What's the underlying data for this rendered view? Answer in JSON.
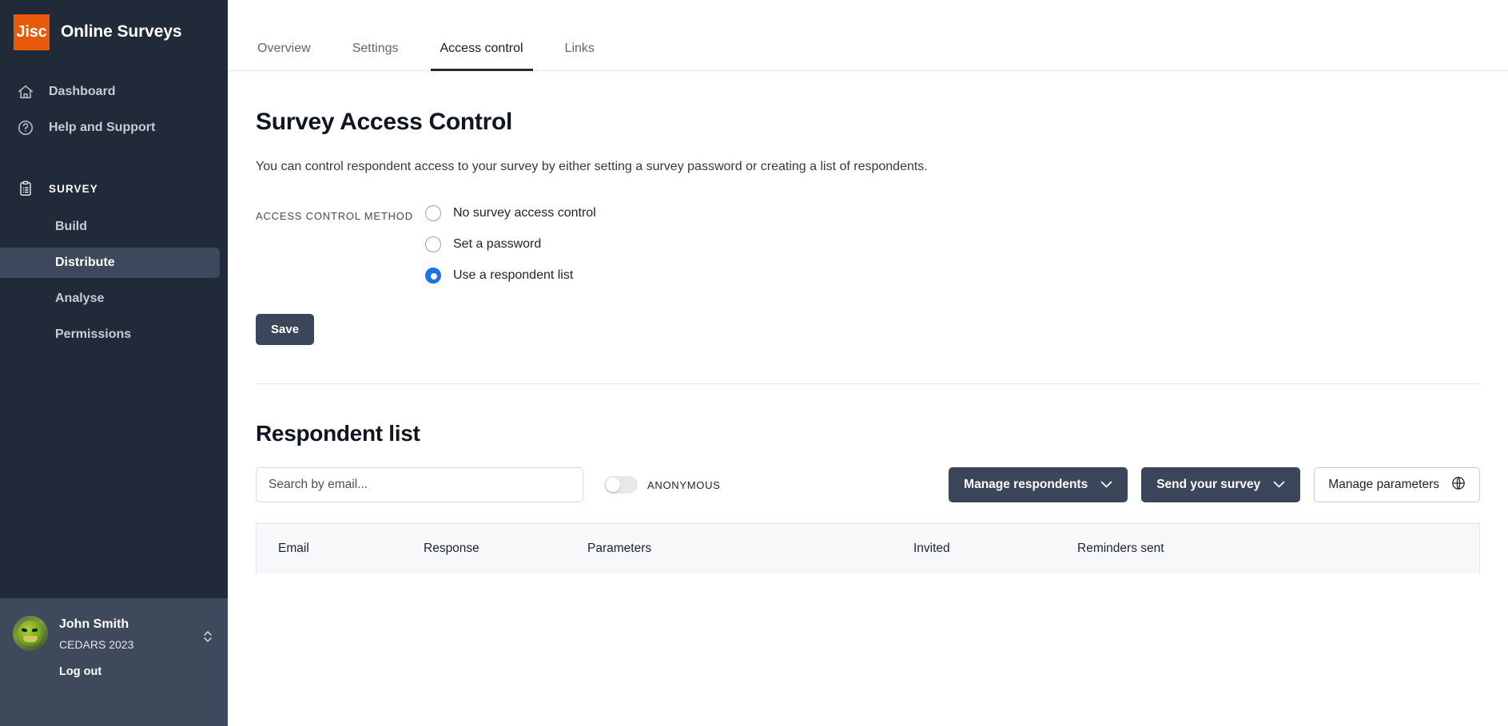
{
  "brand": {
    "logo_text": "Jisc",
    "logo_color": "#e8590c",
    "title": "Online Surveys"
  },
  "sidebar": {
    "background": "#212a39",
    "nav_top": [
      {
        "label": "Dashboard",
        "icon": "home-icon"
      },
      {
        "label": "Help and Support",
        "icon": "question-circle-icon"
      }
    ],
    "section": {
      "label": "SURVEY",
      "icon": "clipboard-list-icon"
    },
    "sub_items": [
      {
        "label": "Build",
        "active": false
      },
      {
        "label": "Distribute",
        "active": true
      },
      {
        "label": "Analyse",
        "active": false
      },
      {
        "label": "Permissions",
        "active": false
      }
    ],
    "user": {
      "name": "John Smith",
      "org": "CEDARS 2023",
      "logout_label": "Log out",
      "avatar_alt": "avatar",
      "switch_icon": "chevron-up-down-icon"
    }
  },
  "tabs": [
    {
      "label": "Overview",
      "active": false
    },
    {
      "label": "Settings",
      "active": false
    },
    {
      "label": "Access control",
      "active": true
    },
    {
      "label": "Links",
      "active": false
    }
  ],
  "main": {
    "page_title": "Survey Access Control",
    "page_description": "You can control respondent access to your survey by either setting a survey password or creating a list of respondents.",
    "access_control": {
      "field_label": "ACCESS CONTROL METHOD",
      "selected_value": "Use a respondent list",
      "accent_color": "#1a73e8",
      "options": [
        {
          "label": "No survey access control",
          "checked": false
        },
        {
          "label": "Set a password",
          "checked": false
        },
        {
          "label": "Use a respondent list",
          "checked": true
        }
      ]
    },
    "save_label": "Save"
  },
  "respondent_list": {
    "section_title": "Respondent list",
    "search": {
      "value": "",
      "placeholder": "Search by email..."
    },
    "anonymous_toggle": {
      "label": "ANONYMOUS",
      "on": false
    },
    "buttons": [
      {
        "label": "Manage respondents",
        "style": "dark",
        "icon": "chevron-down-icon"
      },
      {
        "label": "Send your survey",
        "style": "dark",
        "icon": "chevron-down-icon"
      },
      {
        "label": "Manage parameters",
        "style": "light",
        "icon": "globe-icon"
      }
    ],
    "table": {
      "columns": [
        "Email",
        "Response",
        "Parameters",
        "Invited",
        "Reminders sent"
      ],
      "rows": []
    }
  }
}
